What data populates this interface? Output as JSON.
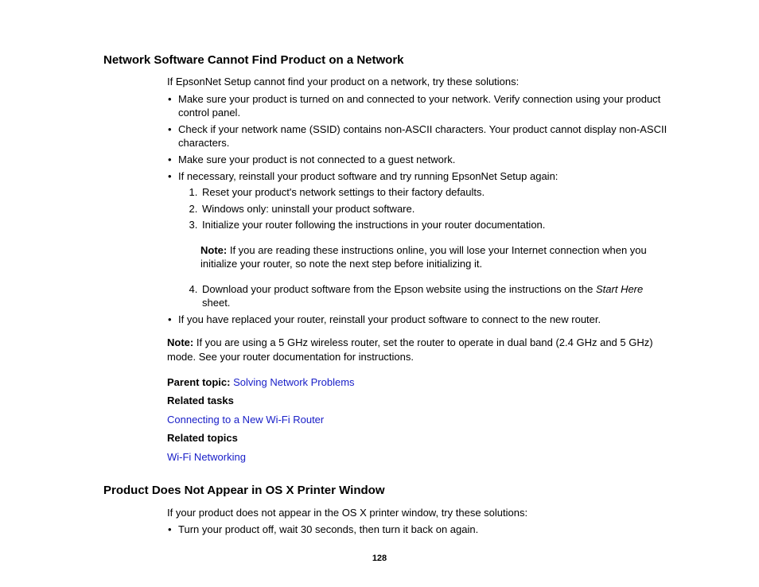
{
  "section1": {
    "heading": "Network Software Cannot Find Product on a Network",
    "intro": "If EpsonNet Setup cannot find your product on a network, try these solutions:",
    "bullets": {
      "b1": "Make sure your product is turned on and connected to your network. Verify connection using your product control panel.",
      "b2": "Check if your network name (SSID) contains non-ASCII characters. Your product cannot display non-ASCII characters.",
      "b3": "Make sure your product is not connected to a guest network.",
      "b4": "If necessary, reinstall your product software and try running EpsonNet Setup again:",
      "steps": {
        "s1": "Reset your product's network settings to their factory defaults.",
        "s2": "Windows only: uninstall your product software.",
        "s3": "Initialize your router following the instructions in your router documentation.",
        "note_label": "Note:",
        "note_body": " If you are reading these instructions online, you will lose your Internet connection when you initialize your router, so note the next step before initializing it.",
        "s4a": "Download your product software from the Epson website using the instructions on the ",
        "s4i": "Start Here",
        "s4b": " sheet."
      },
      "b5": "If you have replaced your router, reinstall your product software to connect to the new router."
    },
    "note2_label": "Note:",
    "note2_body": " If you are using a 5 GHz wireless router, set the router to operate in dual band (2.4 GHz and 5 GHz) mode. See your router documentation for instructions.",
    "parent_label": "Parent topic:",
    "parent_link": "Solving Network Problems",
    "related_tasks_label": "Related tasks",
    "related_task_link": "Connecting to a New Wi-Fi Router",
    "related_topics_label": "Related topics",
    "related_topic_link": "Wi-Fi Networking"
  },
  "section2": {
    "heading": "Product Does Not Appear in OS X Printer Window",
    "intro": "If your product does not appear in the OS X printer window, try these solutions:",
    "b1": "Turn your product off, wait 30 seconds, then turn it back on again."
  },
  "page_number": "128"
}
